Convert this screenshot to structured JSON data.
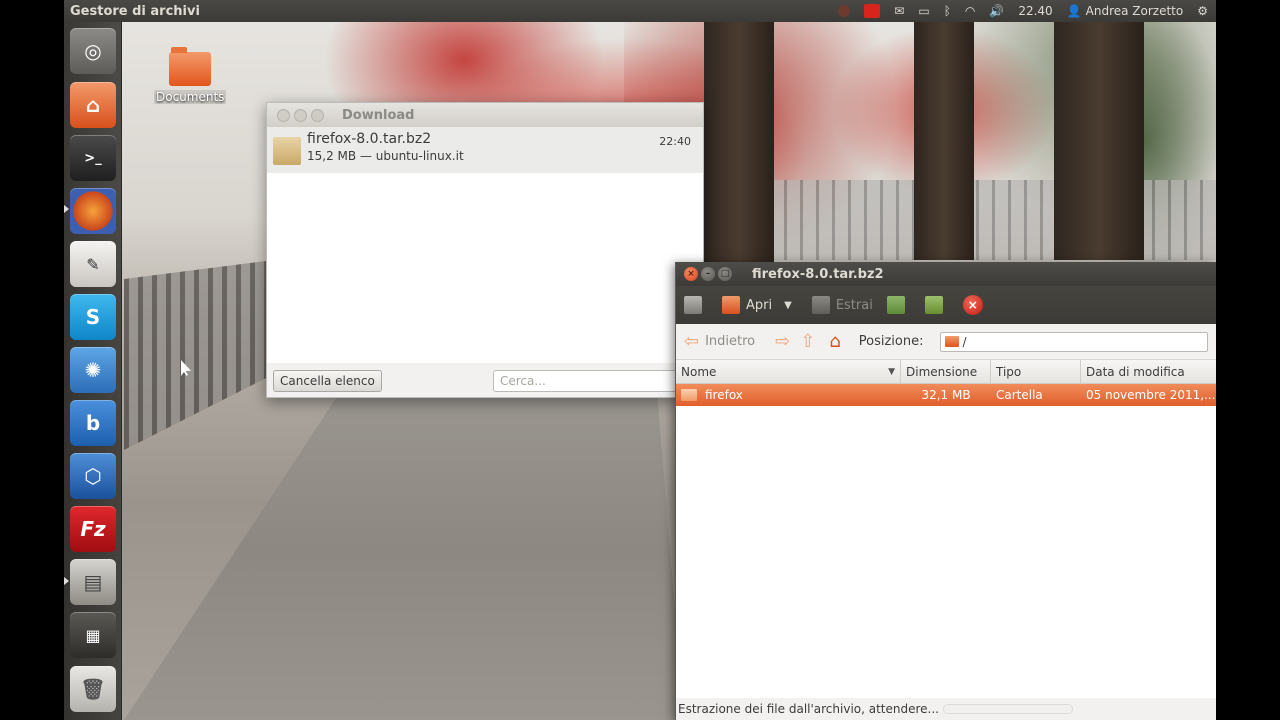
{
  "top_panel": {
    "app_title": "Gestore di archivi",
    "clock": "22.40",
    "user": "Andrea Zorzetto",
    "indicators": [
      "mail-icon",
      "battery-icon",
      "bluetooth-icon",
      "wifi-icon",
      "volume-icon",
      "session-gear-icon"
    ]
  },
  "launcher": {
    "items": [
      {
        "name": "dash-home",
        "color": "#9a9894"
      },
      {
        "name": "home-folder",
        "color": "#e2561d"
      },
      {
        "name": "terminal",
        "color": "#2b2b2b",
        "glyph": ">_"
      },
      {
        "name": "firefox",
        "color": "#e56a1f"
      },
      {
        "name": "text-editor",
        "color": "#d8d6d1"
      },
      {
        "name": "skype",
        "color": "#1aa3e0",
        "glyph": "S"
      },
      {
        "name": "app-swirl",
        "color": "#3c8fd6"
      },
      {
        "name": "app-b",
        "color": "#2f78c9",
        "glyph": "b"
      },
      {
        "name": "virtualbox",
        "color": "#2a6bb8"
      },
      {
        "name": "filezilla",
        "color": "#c4151a",
        "glyph": "Fz"
      },
      {
        "name": "archive-manager",
        "color": "#bdbab3"
      },
      {
        "name": "workspace-switcher",
        "color": "#6e6c67"
      },
      {
        "name": "trash",
        "color": "#d8d6d1"
      }
    ]
  },
  "desktop": {
    "folder_label": "Documents"
  },
  "download_window": {
    "title": "Download",
    "item": {
      "filename": "firefox-8.0.tar.bz2",
      "details": "15,2 MB — ubuntu-linux.it",
      "time": "22:40"
    },
    "clear_button": "Cancella elenco",
    "search_placeholder": "Cerca..."
  },
  "archive_window": {
    "title": "firefox-8.0.tar.bz2",
    "toolbar": {
      "open_label": "Apri",
      "extract_label": "Estrai"
    },
    "location": {
      "back_label": "Indietro",
      "position_label": "Posizione:",
      "path": "/"
    },
    "columns": [
      "Nome",
      "Dimensione",
      "Tipo",
      "Data di modifica"
    ],
    "rows": [
      {
        "name": "firefox",
        "size": "32,1 MB",
        "type": "Cartella",
        "date": "05 novembre 2011,..."
      }
    ],
    "status": "Estrazione dei file dall'archivio, attendere..."
  }
}
